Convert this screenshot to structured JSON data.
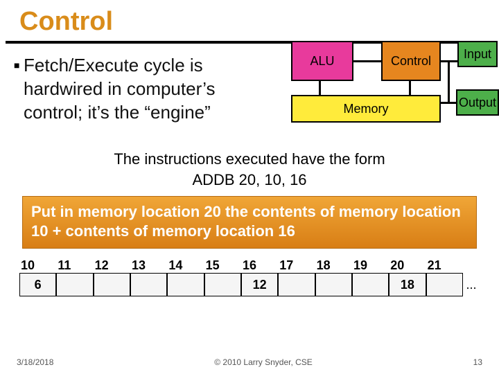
{
  "title": "Control",
  "bullet": "Fetch/Execute cycle is hardwired in computer’s control; it’s the “engine”",
  "diagram": {
    "alu": "ALU",
    "control": "Control",
    "input": "Input",
    "output": "Output",
    "memory": "Memory"
  },
  "instruction": {
    "line1": "The instructions executed have the form",
    "line2": "ADDB 20, 10, 16"
  },
  "explain": "Put in memory location 20 the contents of memory location 10 + contents of memory location 16",
  "memory": {
    "addresses": [
      "10",
      "11",
      "12",
      "13",
      "14",
      "15",
      "16",
      "17",
      "18",
      "19",
      "20",
      "21"
    ],
    "values": [
      "6",
      "",
      "",
      "",
      "",
      "",
      "12",
      "",
      "",
      "",
      "18",
      ""
    ],
    "ellipsis": "..."
  },
  "footer": {
    "date": "3/18/2018",
    "copyright": "© 2010 Larry Snyder, CSE",
    "page": "13"
  }
}
